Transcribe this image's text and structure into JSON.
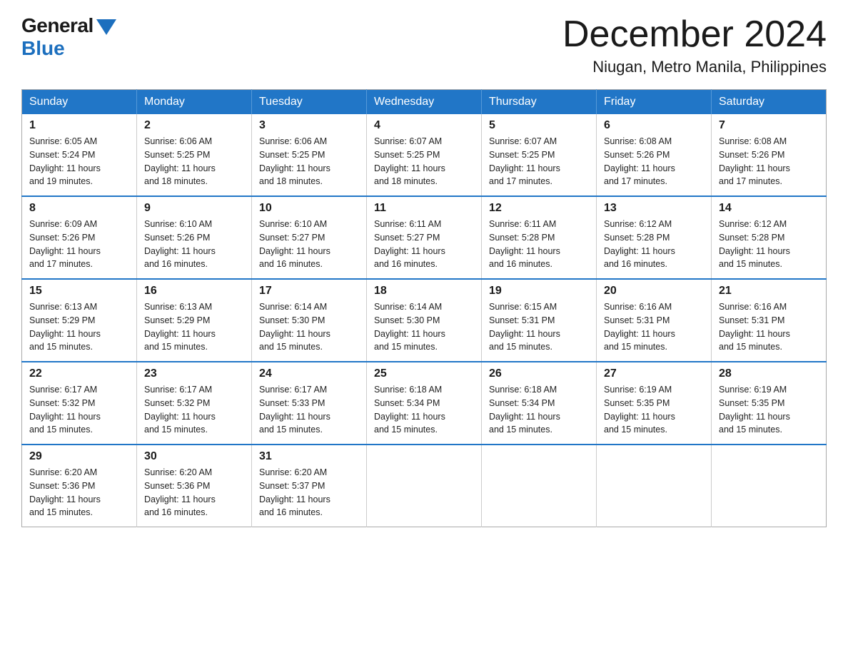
{
  "logo": {
    "general": "General",
    "blue": "Blue"
  },
  "header": {
    "month_year": "December 2024",
    "location": "Niugan, Metro Manila, Philippines"
  },
  "days_of_week": [
    "Sunday",
    "Monday",
    "Tuesday",
    "Wednesday",
    "Thursday",
    "Friday",
    "Saturday"
  ],
  "weeks": [
    [
      {
        "day": "1",
        "sunrise": "6:05 AM",
        "sunset": "5:24 PM",
        "daylight": "11 hours and 19 minutes."
      },
      {
        "day": "2",
        "sunrise": "6:06 AM",
        "sunset": "5:25 PM",
        "daylight": "11 hours and 18 minutes."
      },
      {
        "day": "3",
        "sunrise": "6:06 AM",
        "sunset": "5:25 PM",
        "daylight": "11 hours and 18 minutes."
      },
      {
        "day": "4",
        "sunrise": "6:07 AM",
        "sunset": "5:25 PM",
        "daylight": "11 hours and 18 minutes."
      },
      {
        "day": "5",
        "sunrise": "6:07 AM",
        "sunset": "5:25 PM",
        "daylight": "11 hours and 17 minutes."
      },
      {
        "day": "6",
        "sunrise": "6:08 AM",
        "sunset": "5:26 PM",
        "daylight": "11 hours and 17 minutes."
      },
      {
        "day": "7",
        "sunrise": "6:08 AM",
        "sunset": "5:26 PM",
        "daylight": "11 hours and 17 minutes."
      }
    ],
    [
      {
        "day": "8",
        "sunrise": "6:09 AM",
        "sunset": "5:26 PM",
        "daylight": "11 hours and 17 minutes."
      },
      {
        "day": "9",
        "sunrise": "6:10 AM",
        "sunset": "5:26 PM",
        "daylight": "11 hours and 16 minutes."
      },
      {
        "day": "10",
        "sunrise": "6:10 AM",
        "sunset": "5:27 PM",
        "daylight": "11 hours and 16 minutes."
      },
      {
        "day": "11",
        "sunrise": "6:11 AM",
        "sunset": "5:27 PM",
        "daylight": "11 hours and 16 minutes."
      },
      {
        "day": "12",
        "sunrise": "6:11 AM",
        "sunset": "5:28 PM",
        "daylight": "11 hours and 16 minutes."
      },
      {
        "day": "13",
        "sunrise": "6:12 AM",
        "sunset": "5:28 PM",
        "daylight": "11 hours and 16 minutes."
      },
      {
        "day": "14",
        "sunrise": "6:12 AM",
        "sunset": "5:28 PM",
        "daylight": "11 hours and 15 minutes."
      }
    ],
    [
      {
        "day": "15",
        "sunrise": "6:13 AM",
        "sunset": "5:29 PM",
        "daylight": "11 hours and 15 minutes."
      },
      {
        "day": "16",
        "sunrise": "6:13 AM",
        "sunset": "5:29 PM",
        "daylight": "11 hours and 15 minutes."
      },
      {
        "day": "17",
        "sunrise": "6:14 AM",
        "sunset": "5:30 PM",
        "daylight": "11 hours and 15 minutes."
      },
      {
        "day": "18",
        "sunrise": "6:14 AM",
        "sunset": "5:30 PM",
        "daylight": "11 hours and 15 minutes."
      },
      {
        "day": "19",
        "sunrise": "6:15 AM",
        "sunset": "5:31 PM",
        "daylight": "11 hours and 15 minutes."
      },
      {
        "day": "20",
        "sunrise": "6:16 AM",
        "sunset": "5:31 PM",
        "daylight": "11 hours and 15 minutes."
      },
      {
        "day": "21",
        "sunrise": "6:16 AM",
        "sunset": "5:31 PM",
        "daylight": "11 hours and 15 minutes."
      }
    ],
    [
      {
        "day": "22",
        "sunrise": "6:17 AM",
        "sunset": "5:32 PM",
        "daylight": "11 hours and 15 minutes."
      },
      {
        "day": "23",
        "sunrise": "6:17 AM",
        "sunset": "5:32 PM",
        "daylight": "11 hours and 15 minutes."
      },
      {
        "day": "24",
        "sunrise": "6:17 AM",
        "sunset": "5:33 PM",
        "daylight": "11 hours and 15 minutes."
      },
      {
        "day": "25",
        "sunrise": "6:18 AM",
        "sunset": "5:34 PM",
        "daylight": "11 hours and 15 minutes."
      },
      {
        "day": "26",
        "sunrise": "6:18 AM",
        "sunset": "5:34 PM",
        "daylight": "11 hours and 15 minutes."
      },
      {
        "day": "27",
        "sunrise": "6:19 AM",
        "sunset": "5:35 PM",
        "daylight": "11 hours and 15 minutes."
      },
      {
        "day": "28",
        "sunrise": "6:19 AM",
        "sunset": "5:35 PM",
        "daylight": "11 hours and 15 minutes."
      }
    ],
    [
      {
        "day": "29",
        "sunrise": "6:20 AM",
        "sunset": "5:36 PM",
        "daylight": "11 hours and 15 minutes."
      },
      {
        "day": "30",
        "sunrise": "6:20 AM",
        "sunset": "5:36 PM",
        "daylight": "11 hours and 16 minutes."
      },
      {
        "day": "31",
        "sunrise": "6:20 AM",
        "sunset": "5:37 PM",
        "daylight": "11 hours and 16 minutes."
      },
      null,
      null,
      null,
      null
    ]
  ],
  "labels": {
    "sunrise": "Sunrise:",
    "sunset": "Sunset:",
    "daylight": "Daylight:"
  }
}
